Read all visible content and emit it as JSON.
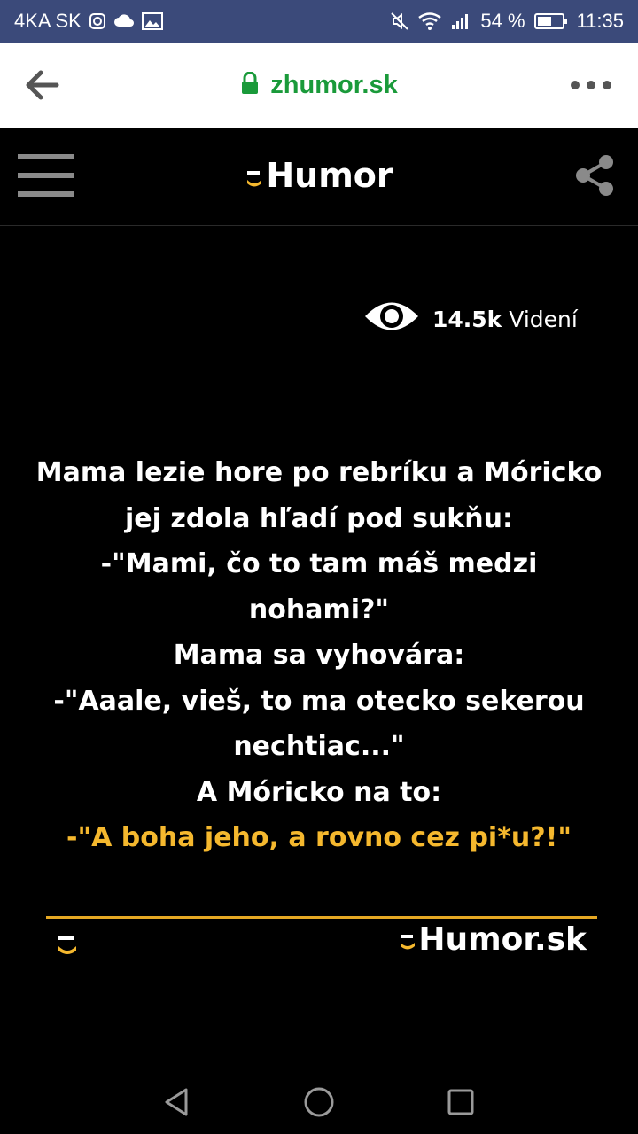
{
  "status_bar": {
    "carrier": "4KA SK",
    "battery": "54 %",
    "time": "11:35",
    "icons": [
      "instagram-icon",
      "cloud-icon",
      "gallery-icon",
      "mute-icon",
      "wifi-icon",
      "signal-icon",
      "battery-icon"
    ]
  },
  "browser": {
    "url": "zhumor.sk",
    "icons": [
      "back-arrow-icon",
      "lock-icon",
      "more-dots-icon"
    ]
  },
  "header": {
    "logo_text": "Humor",
    "icons": [
      "hamburger-menu-icon",
      "share-icon"
    ]
  },
  "views": {
    "count": "14.5k",
    "label": "Videní",
    "icon": "eye-icon"
  },
  "joke": {
    "lines": [
      "Mama lezie hore po rebríku a Móricko",
      "jej zdola hľadí pod sukňu:",
      "-\"Mami, čo to tam máš medzi",
      "nohami?\"",
      "Mama sa vyhovára:",
      "-\"Aaale, vieš, to ma otecko sekerou",
      "nechtiac...\"",
      "A Móricko na to:"
    ],
    "punchline": "-\"A boha jeho, a rovno cez pi*u?!\""
  },
  "footer": {
    "brand_text": "Humor.sk"
  },
  "colors": {
    "status_bar": "#3b4a7a",
    "url_green": "#1a9a3a",
    "accent_yellow": "#f5b82e"
  }
}
